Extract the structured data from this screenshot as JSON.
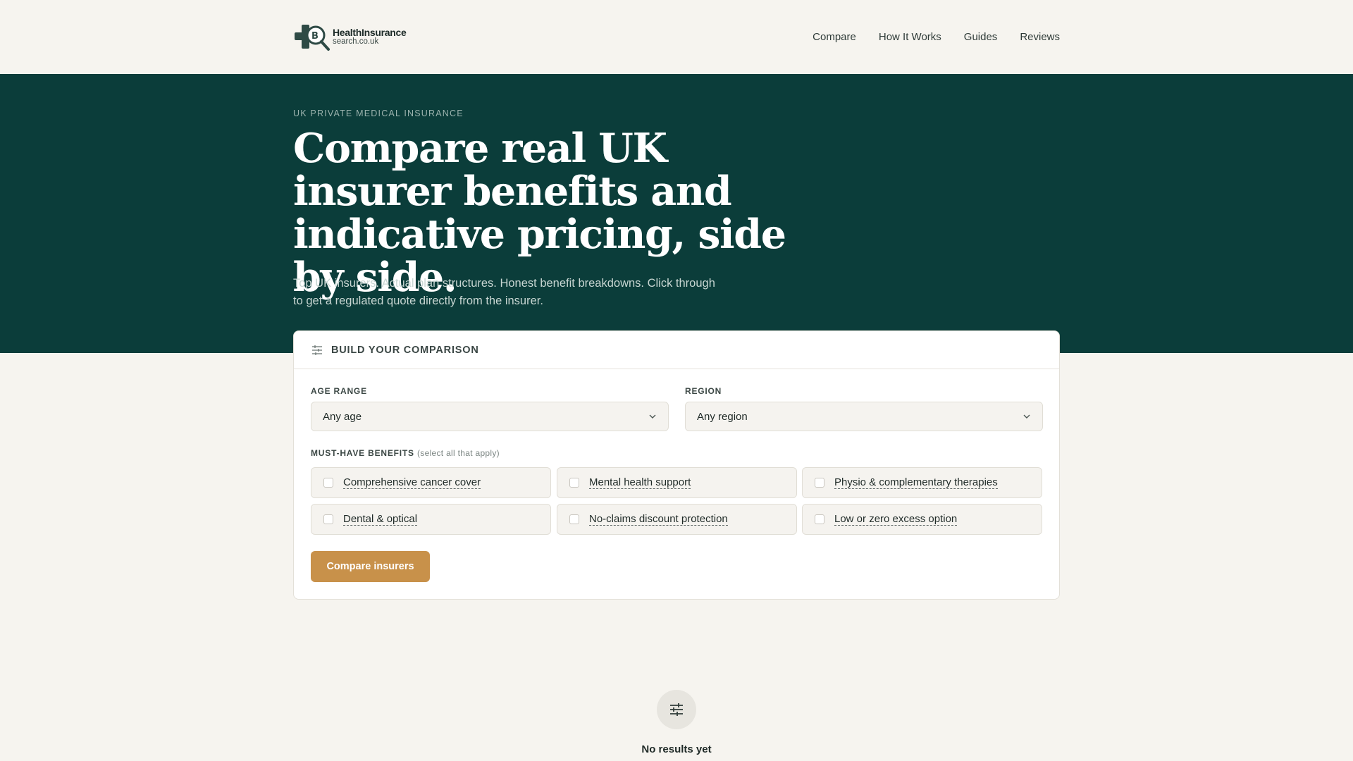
{
  "header": {
    "logo": {
      "line1": "HealthInsurance",
      "line2": "search.co.uk"
    },
    "nav": [
      {
        "label": "Compare"
      },
      {
        "label": "How It Works"
      },
      {
        "label": "Guides"
      },
      {
        "label": "Reviews"
      }
    ]
  },
  "hero": {
    "eyebrow": "UK PRIVATE MEDICAL INSURANCE",
    "title": "Compare real UK insurer benefits and indicative pricing, side by side.",
    "subtitle": "Top UK insurers. Actual plan structures. Honest benefit breakdowns. Click through to get a regulated quote directly from the insurer."
  },
  "comparison": {
    "title": "BUILD YOUR COMPARISON",
    "icon": "sliders-icon",
    "age_range": {
      "label": "AGE RANGE",
      "value": "Any age"
    },
    "region": {
      "label": "REGION",
      "value": "Any region"
    },
    "benefits_label": "MUST-HAVE BENEFITS",
    "benefits_hint": "(select all that apply)",
    "benefits": [
      {
        "label": "Comprehensive cancer cover",
        "checked": false
      },
      {
        "label": "Mental health support",
        "checked": false
      },
      {
        "label": "Physio & complementary therapies",
        "checked": false
      },
      {
        "label": "Dental & optical",
        "checked": false
      },
      {
        "label": "No-claims discount protection",
        "checked": false
      },
      {
        "label": "Low or zero excess option",
        "checked": false
      }
    ],
    "button_label": "Compare insurers"
  },
  "empty_state": {
    "icon": "sliders-icon",
    "title": "No results yet"
  },
  "colors": {
    "hero_bg": "#0b3d3a",
    "page_bg": "#f6f4ef",
    "accent": "#c8914a"
  }
}
